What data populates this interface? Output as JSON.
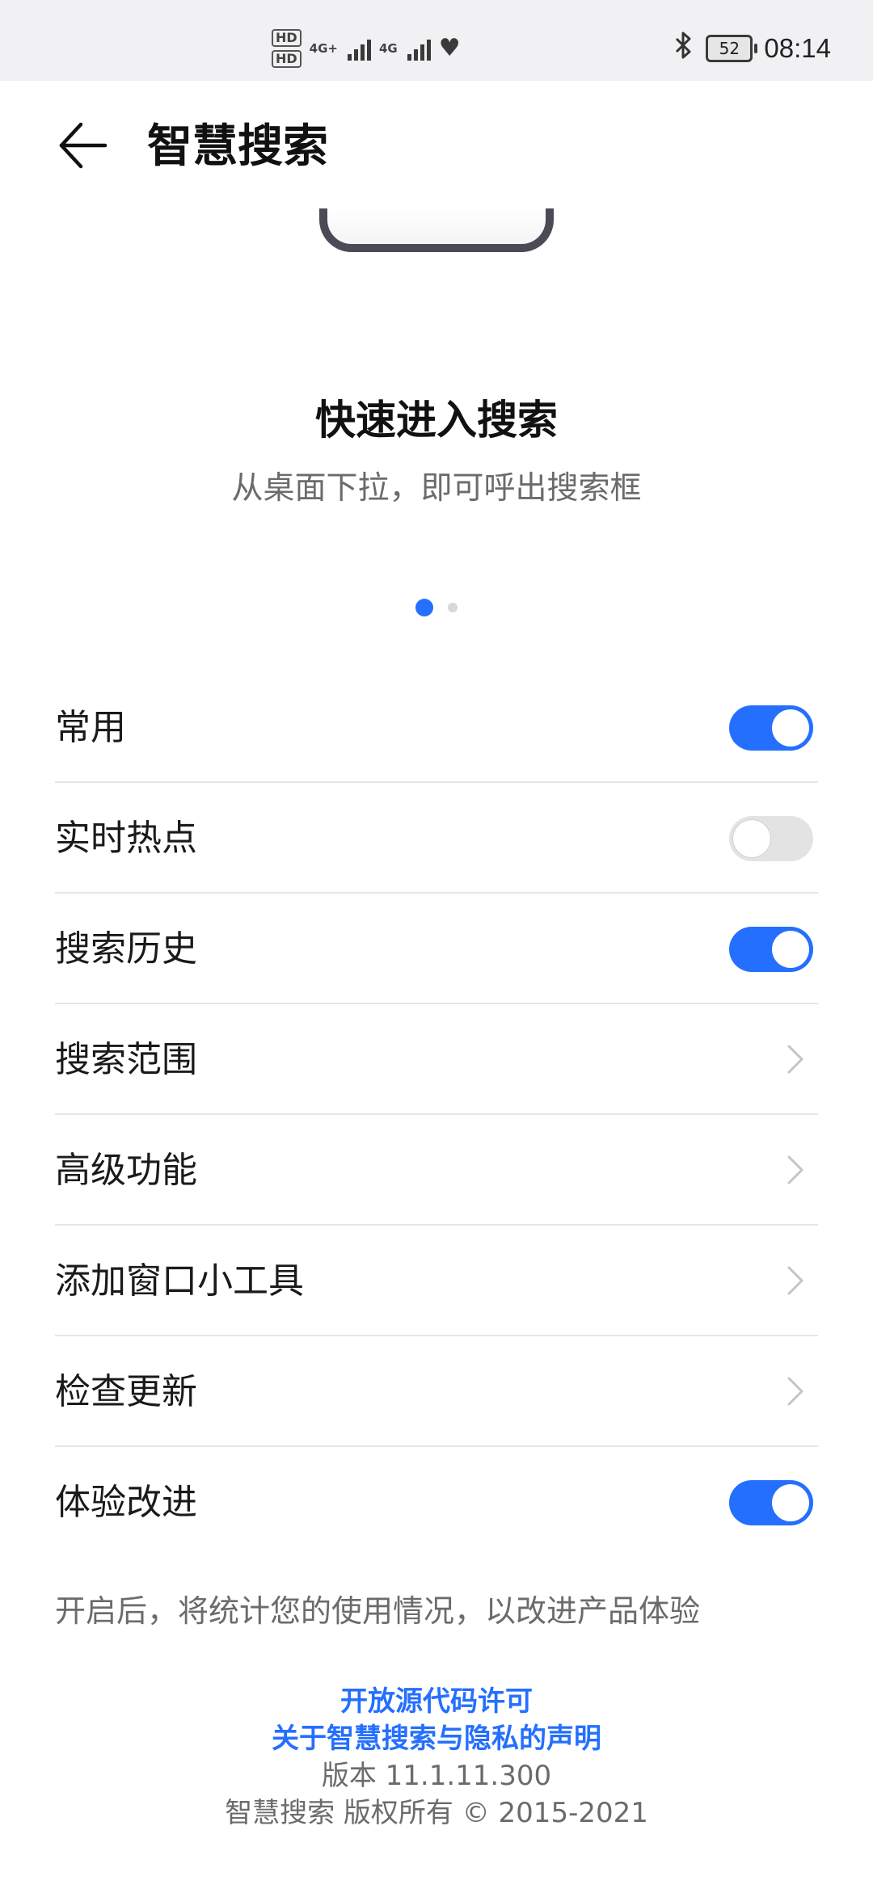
{
  "status_bar": {
    "hd1": "HD",
    "hd2": "HD",
    "net1": "4G+",
    "net2": "4G",
    "battery": "52",
    "time": "08:14",
    "icons": [
      "bluetooth-icon",
      "heart-health-icon",
      "signal-icon",
      "battery-icon"
    ]
  },
  "header": {
    "title": "智慧搜索",
    "back_icon": "back-arrow-icon"
  },
  "carousel": {
    "title": "快速进入搜索",
    "subtitle": "从桌面下拉，即可呼出搜索框",
    "page_count": 2,
    "active_index": 0
  },
  "settings": {
    "items": [
      {
        "label": "常用",
        "type": "switch",
        "on": true
      },
      {
        "label": "实时热点",
        "type": "switch",
        "on": false
      },
      {
        "label": "搜索历史",
        "type": "switch",
        "on": true
      },
      {
        "label": "搜索范围",
        "type": "nav"
      },
      {
        "label": "高级功能",
        "type": "nav"
      },
      {
        "label": "添加窗口小工具",
        "type": "nav"
      },
      {
        "label": "检查更新",
        "type": "nav"
      },
      {
        "label": "体验改进",
        "type": "switch",
        "on": true
      }
    ],
    "footnote": "开启后，将统计您的使用情况，以改进产品体验"
  },
  "footer": {
    "license_link": "开放源代码许可",
    "privacy_link": "关于智慧搜索与隐私的声明",
    "version": "版本 11.1.11.300",
    "copyright": "智慧搜索 版权所有 © 2015-2021"
  },
  "colors": {
    "accent": "#256fff",
    "switch_off": "#e3e3e3",
    "status_bar_bg": "#f1f1f3",
    "divider": "#e6e6e6",
    "secondary_text": "#6b6b6b"
  }
}
